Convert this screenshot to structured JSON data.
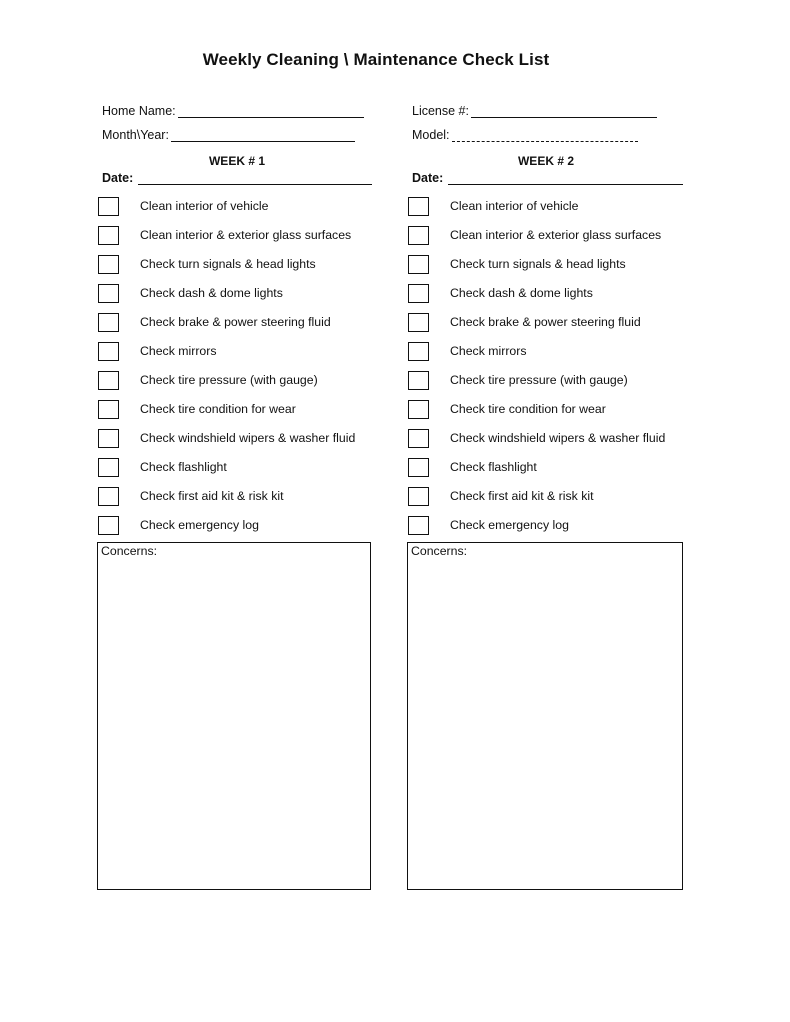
{
  "title": "Weekly Cleaning \\ Maintenance Check List",
  "fields": {
    "home_name": {
      "label": "Home Name:",
      "value": ""
    },
    "month_year": {
      "label": "Month\\Year:",
      "value": ""
    },
    "license": {
      "label": "License #:",
      "value": ""
    },
    "model": {
      "label": "Model:",
      "value": ""
    }
  },
  "weeks": [
    {
      "title": "WEEK # 1",
      "date_label": "Date:",
      "date_value": "",
      "items": [
        {
          "label": "Clean interior of vehicle",
          "checked": false
        },
        {
          "label": "Clean interior & exterior glass surfaces",
          "checked": false
        },
        {
          "label": "Check turn signals & head lights",
          "checked": false
        },
        {
          "label": "Check dash & dome lights",
          "checked": false
        },
        {
          "label": "Check brake & power steering fluid",
          "checked": false
        },
        {
          "label": "Check mirrors",
          "checked": false
        },
        {
          "label": "Check tire pressure (with gauge)",
          "checked": false
        },
        {
          "label": "Check tire condition for wear",
          "checked": false
        },
        {
          "label": "Check windshield wipers & washer fluid",
          "checked": false
        },
        {
          "label": "Check flashlight",
          "checked": false
        },
        {
          "label": "Check first aid kit & risk kit",
          "checked": false
        },
        {
          "label": "Check emergency log",
          "checked": false
        }
      ],
      "concerns_label": "Concerns:",
      "concerns_value": ""
    },
    {
      "title": "WEEK # 2",
      "date_label": "Date:",
      "date_value": "",
      "items": [
        {
          "label": "Clean interior of vehicle",
          "checked": false
        },
        {
          "label": "Clean interior & exterior glass surfaces",
          "checked": false
        },
        {
          "label": "Check turn signals & head lights",
          "checked": false
        },
        {
          "label": "Check dash & dome lights",
          "checked": false
        },
        {
          "label": "Check brake & power steering fluid",
          "checked": false
        },
        {
          "label": "Check mirrors",
          "checked": false
        },
        {
          "label": "Check tire pressure (with gauge)",
          "checked": false
        },
        {
          "label": "Check tire condition for wear",
          "checked": false
        },
        {
          "label": "Check windshield wipers & washer fluid",
          "checked": false
        },
        {
          "label": "Check flashlight",
          "checked": false
        },
        {
          "label": "Check first aid kit & risk kit",
          "checked": false
        },
        {
          "label": "Check emergency log",
          "checked": false
        }
      ],
      "concerns_label": "Concerns:",
      "concerns_value": ""
    }
  ]
}
